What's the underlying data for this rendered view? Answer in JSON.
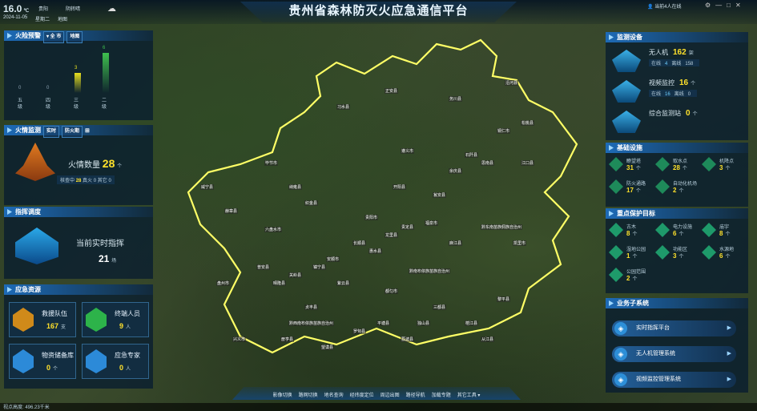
{
  "header": {
    "title": "贵州省森林防灭火应急通信平台",
    "temperature": "16.0",
    "temp_unit": "℃",
    "location": "贵阳",
    "weather": "阴转晴",
    "date": "2024-11-05",
    "weekday": "星期二",
    "map_btn": "地图",
    "online": "当前4人在线"
  },
  "fire_warning": {
    "title": "火险预警",
    "toggle": "▾ 全 市",
    "mode": "地图",
    "levels": [
      {
        "label": "五级",
        "value": "0",
        "color": "#8aa0b0"
      },
      {
        "label": "四级",
        "value": "0",
        "color": "#8aa0b0"
      },
      {
        "label": "三级",
        "value": "3",
        "color": "#e8e020"
      },
      {
        "label": "二级",
        "value": "6",
        "color": "#3fbf4f"
      }
    ]
  },
  "fire_monitor": {
    "title": "火情监测",
    "tab1": "实时",
    "tab2": "防火期",
    "count_label": "火情数量",
    "count": "28",
    "count_unit": "个",
    "checking_label": "核查中",
    "checking": "28",
    "real_label": "真火",
    "real": "0",
    "other_label": "其它",
    "other": "0"
  },
  "command": {
    "title": "指挥调度",
    "label": "当前实时指挥",
    "count": "21",
    "unit": "场"
  },
  "resources": {
    "title": "应急资源",
    "items": [
      {
        "label": "救援队伍",
        "value": "167",
        "unit": "支",
        "color": "#d08a1a"
      },
      {
        "label": "终端人员",
        "value": "9",
        "unit": "人",
        "color": "#2db34a"
      },
      {
        "label": "物资储备库",
        "value": "0",
        "unit": "个",
        "color": "#2c8ad8"
      },
      {
        "label": "应急专家",
        "value": "0",
        "unit": "人",
        "color": "#2c8ad8"
      }
    ]
  },
  "monitoring": {
    "title": "监测设备",
    "items": [
      {
        "label": "无人机",
        "value": "162",
        "unit": "架",
        "online_label": "在线",
        "online": "4",
        "offline_label": "离线",
        "offline": "158"
      },
      {
        "label": "视频监控",
        "value": "16",
        "unit": "个",
        "online_label": "在线",
        "online": "16",
        "offline_label": "离线",
        "offline": "0"
      },
      {
        "label": "综合监测站",
        "value": "0",
        "unit": "个",
        "online_label": "",
        "online": "",
        "offline_label": "",
        "offline": ""
      }
    ]
  },
  "infrastructure": {
    "title": "基础设施",
    "items": [
      {
        "label": "瞭望塔",
        "value": "31",
        "unit": "个"
      },
      {
        "label": "取水点",
        "value": "28",
        "unit": "个"
      },
      {
        "label": "机降点",
        "value": "3",
        "unit": "个"
      },
      {
        "label": "防火通路",
        "value": "17",
        "unit": "个"
      },
      {
        "label": "自动化机场",
        "value": "2",
        "unit": "个"
      }
    ]
  },
  "protect": {
    "title": "重点保护目标",
    "items": [
      {
        "label": "古木",
        "value": "8",
        "unit": "个"
      },
      {
        "label": "电力设施",
        "value": "6",
        "unit": "个"
      },
      {
        "label": "庙宇",
        "value": "8",
        "unit": "个"
      },
      {
        "label": "湿地公园",
        "value": "1",
        "unit": "个"
      },
      {
        "label": "功能区",
        "value": "3",
        "unit": "个"
      },
      {
        "label": "水源地",
        "value": "6",
        "unit": "个"
      },
      {
        "label": "公园范围",
        "value": "2",
        "unit": "个"
      }
    ]
  },
  "business": {
    "title": "业务子系统",
    "items": [
      {
        "label": "实时指挥平台"
      },
      {
        "label": "无人机管理系统"
      },
      {
        "label": "视频监控管理系统"
      }
    ]
  },
  "toolbar": {
    "items": [
      "影像切换",
      "路网切换",
      "地名查询",
      "经纬度定位",
      "周边出图",
      "路径导航",
      "加载专题",
      "其它工具 ▾"
    ]
  },
  "footer": {
    "status": "视点高度: 496.23千米"
  },
  "map_labels": [
    "贵阳市",
    "安顺市",
    "六盘水市",
    "毕节市",
    "遵义市",
    "铜仁市",
    "黔东南苗族侗族自治州",
    "黔南布依族苗族自治州",
    "黔西南布依族苗族自治州",
    "习水县",
    "正安县",
    "务川县",
    "沿河县",
    "松桃县",
    "思南县",
    "凯里市",
    "都匀市",
    "兴义市",
    "盘州市",
    "威宁县",
    "赫章县",
    "纳雍县",
    "织金县",
    "开阳县",
    "瓮安县",
    "福泉市",
    "余庆县",
    "石阡县",
    "江口县",
    "黎平县",
    "榕江县",
    "从江县",
    "荔波县",
    "三都县",
    "独山县",
    "平塘县",
    "罗甸县",
    "望谟县",
    "册亨县",
    "贞丰县",
    "普安县",
    "晴隆县",
    "关岭县",
    "镇宁县",
    "紫云县",
    "长顺县",
    "惠水县",
    "龙里县",
    "贵定县",
    "麻江县"
  ]
}
